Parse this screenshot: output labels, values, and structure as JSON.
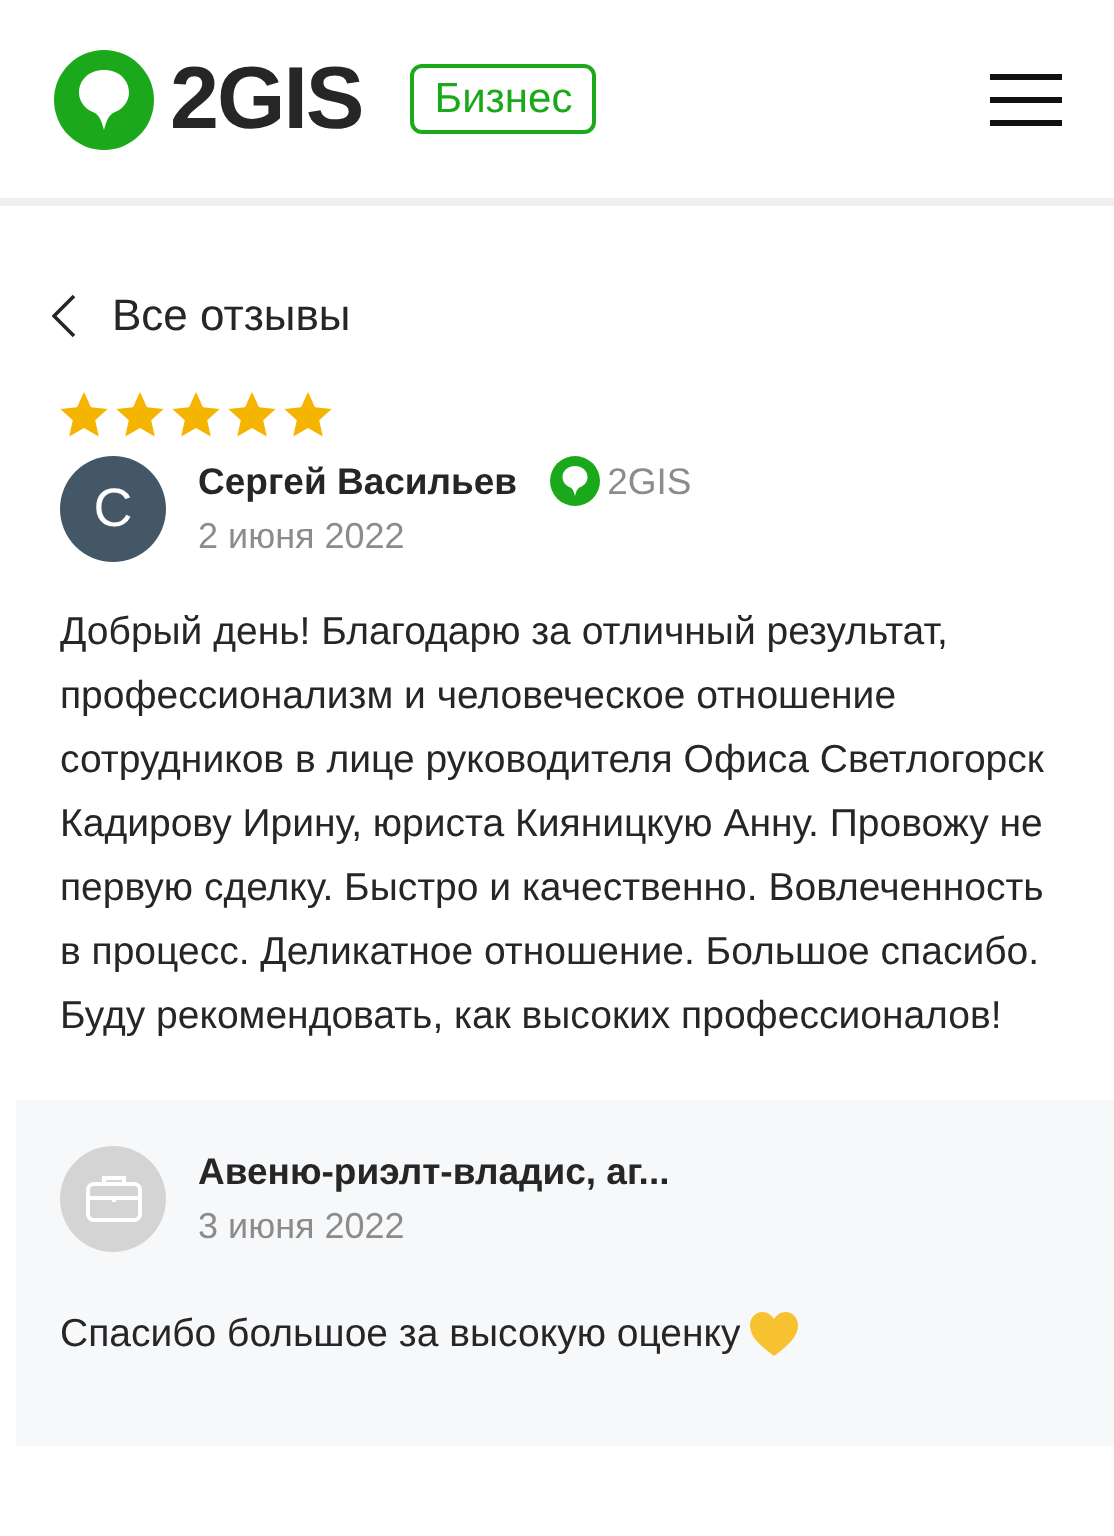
{
  "header": {
    "logo_text": "2GIS",
    "badge": "Бизнес"
  },
  "back": {
    "label": "Все отзывы"
  },
  "review": {
    "stars": 5,
    "avatar_letter": "С",
    "author": "Сергей Васильев",
    "source": "2GIS",
    "date": "2 июня 2022",
    "text": "Добрый день! Благодарю за отличный результат, профессионализм и человеческое отношение сотрудников в лице руководителя Офиса Светлогорск Кадирову Ирину, юриста Кияницкую Анну. Провожу не первую сделку. Быстро и качественно. Вовлеченность в процесс. Деликатное отношение. Большое спасибо. Буду рекомендовать, как высоких профессионалов!"
  },
  "reply": {
    "author": "Авеню-риэлт-владис, аг...",
    "date": "3 июня 2022",
    "text": "Спасибо большое за высокую оценку"
  }
}
